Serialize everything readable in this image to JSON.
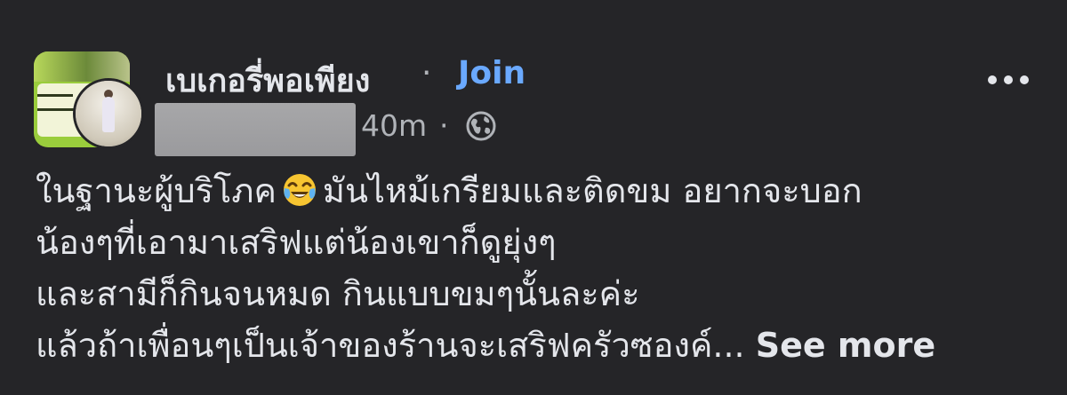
{
  "post": {
    "group_name": "เบเกอรี่พอเพียง",
    "separator": "·",
    "join_label": "Join",
    "timestamp": "40m",
    "timestamp_separator": "·",
    "privacy_icon": "globe-icon",
    "body_lines": [
      {
        "before_emoji": "ในฐานะผู้บริโภค",
        "emoji": "tears-of-joy",
        "after_emoji": "มันไหม้เกรียมและติดขม อยากจะบอก"
      },
      {
        "text": "น้องๆที่เอามาเสริฟแต่น้องเขาก็ดูยุ่งๆ"
      },
      {
        "text": "และสามีก็กินจนหมด กินแบบขมๆนั้นละค่ะ"
      },
      {
        "text": "แล้วถ้าเพื่อนๆเป็นเจ้าของร้านจะเสริฟครัวซองค์...",
        "see_more": "See more"
      }
    ],
    "more_icon": "more-horizontal-icon",
    "colors": {
      "background": "#252528",
      "text": "#e4e6eb",
      "secondary_text": "#b0b3b8",
      "link": "#6aa9ff",
      "redaction": "#9a9a9d"
    }
  }
}
